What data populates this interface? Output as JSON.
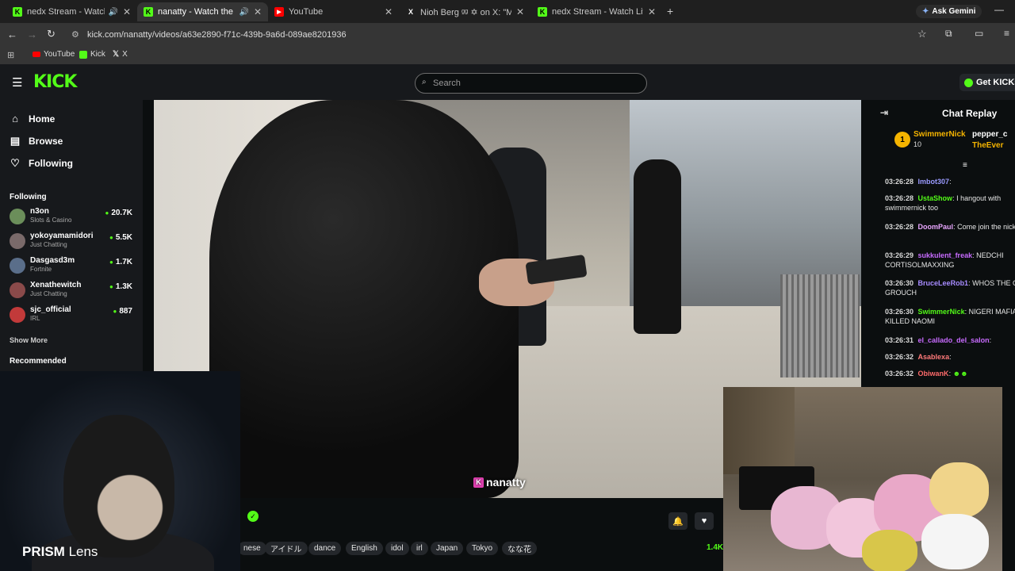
{
  "browser": {
    "tabs": [
      {
        "title": "nedx Stream - Watch Live o",
        "favicon": "K",
        "color": "#53fc18",
        "active": false,
        "audio": true
      },
      {
        "title": "nanatty - Watch the VOD o",
        "favicon": "K",
        "color": "#53fc18",
        "active": true,
        "audio": true
      },
      {
        "title": "YouTube",
        "favicon": "▶",
        "color": "#ff0000",
        "active": false,
        "audio": false
      },
      {
        "title": "Nioh Berg ᵍᵍ ✡ on X: \"Mojtaba",
        "favicon": "X",
        "color": "#ffffff",
        "active": false,
        "audio": false
      },
      {
        "title": "nedx Stream - Watch Live on Ki",
        "favicon": "K",
        "color": "#53fc18",
        "active": false,
        "audio": false
      }
    ],
    "new_tab_label": "+",
    "ask_gemini": "Ask Gemini",
    "url": "kick.com/nanatty/videos/a63e2890-f71c-439b-9a6d-089ae8201936",
    "bookmarks": [
      {
        "label": "YouTube",
        "color": "#ff0000"
      },
      {
        "label": "Kick",
        "color": "#53fc18"
      },
      {
        "label": "X",
        "color": "#ffffff"
      }
    ]
  },
  "kick": {
    "logo": "KICK",
    "search_placeholder": "Search",
    "get_kicks": "Get KICKs",
    "nav": [
      {
        "label": "Home",
        "icon": "home-icon"
      },
      {
        "label": "Browse",
        "icon": "browse-icon"
      },
      {
        "label": "Following",
        "icon": "heart-icon"
      }
    ],
    "following_title": "Following",
    "following": [
      {
        "name": "n3on",
        "category": "Slots & Casino",
        "viewers": "20.7K",
        "avatar": "#6b8e5a"
      },
      {
        "name": "yokoyamamidori",
        "category": "Just Chatting",
        "viewers": "5.5K",
        "avatar": "#7a6a6a"
      },
      {
        "name": "Dasgasd3m",
        "category": "Fortnite",
        "viewers": "1.7K",
        "avatar": "#5a6e8a"
      },
      {
        "name": "Xenathewitch",
        "category": "Just Chatting",
        "viewers": "1.3K",
        "avatar": "#8a4a4a"
      },
      {
        "name": "sjc_official",
        "category": "IRL",
        "viewers": "887",
        "avatar": "#c23a3a"
      }
    ],
    "show_more": "Show More",
    "recommended_title": "Recommended"
  },
  "video": {
    "watermark": "nanatty",
    "tags": [
      "nese",
      "アイドル",
      "dance",
      "English",
      "idol",
      "irl",
      "Japan",
      "Tokyo",
      "なな花"
    ],
    "views_partial": "1.4K"
  },
  "chat": {
    "title": "Chat Replay",
    "top_gifter": {
      "name": "SwimmerNick",
      "count": "10",
      "rank": "1"
    },
    "top_gifters_extra": [
      "pepper_c",
      "TheEver"
    ],
    "messages": [
      {
        "time": "03:26:28",
        "user": "Imbot307",
        "color": "#9a9aff",
        "text": ""
      },
      {
        "time": "03:26:28",
        "user": "UstaShow",
        "color": "#53fc18",
        "text": "I hangout with swimmernick too"
      },
      {
        "time": "03:26:28",
        "user": "DoomPaul",
        "color": "#e9a6ff",
        "text": "Come join the nick"
      },
      {
        "time": "03:26:29",
        "user": "sukkulent_freak",
        "color": "#c86bff",
        "text": "NEDCHI CORTISOLMAXXING"
      },
      {
        "time": "03:26:30",
        "user": "BruceLeeRob1",
        "color": "#a78bff",
        "text": "WHOS THE O GROUCH"
      },
      {
        "time": "03:26:30",
        "user": "SwimmerNick",
        "color": "#53fc18",
        "text": "NIGERI MAFIA KILLED NAOMI"
      },
      {
        "time": "03:26:31",
        "user": "el_callado_del_salon",
        "color": "#c86bff",
        "text": ""
      },
      {
        "time": "03:26:32",
        "user": "Asablexa",
        "color": "#ff7a7a",
        "text": ""
      },
      {
        "time": "03:26:32",
        "user": "ObiwanK",
        "color": "#ff6b6b",
        "text": ""
      }
    ]
  },
  "overlay": {
    "webcam_label_bold": "PRISM",
    "webcam_label_light": " Lens"
  }
}
